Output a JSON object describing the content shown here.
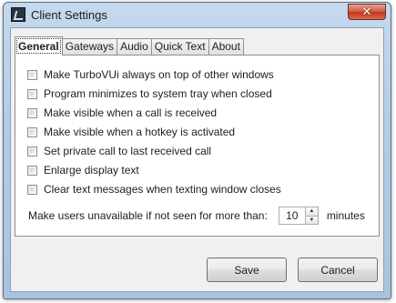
{
  "window": {
    "title": "Client Settings",
    "close_glyph": "✕"
  },
  "tabs": [
    {
      "label": "General",
      "active": true
    },
    {
      "label": "Gateways",
      "active": false
    },
    {
      "label": "Audio",
      "active": false
    },
    {
      "label": "Quick Text",
      "active": false
    },
    {
      "label": "About",
      "active": false
    }
  ],
  "general": {
    "options": [
      {
        "label": "Make TurboVUi always on top of other windows",
        "checked": false
      },
      {
        "label": "Program minimizes to system tray when closed",
        "checked": false
      },
      {
        "label": "Make visible when a call is received",
        "checked": false
      },
      {
        "label": "Make visible when a hotkey is activated",
        "checked": false
      },
      {
        "label": "Set private call to last received call",
        "checked": false
      },
      {
        "label": "Enlarge display text",
        "checked": false
      },
      {
        "label": "Clear text messages when texting window closes",
        "checked": false
      }
    ],
    "unavailable": {
      "label": "Make users unavailable if not seen for more than:",
      "value": "10",
      "units": "minutes"
    }
  },
  "buttons": {
    "save": "Save",
    "cancel": "Cancel"
  },
  "icons": {
    "app": "app-icon",
    "close": "close-icon",
    "spin_up": "▲",
    "spin_down": "▼"
  }
}
